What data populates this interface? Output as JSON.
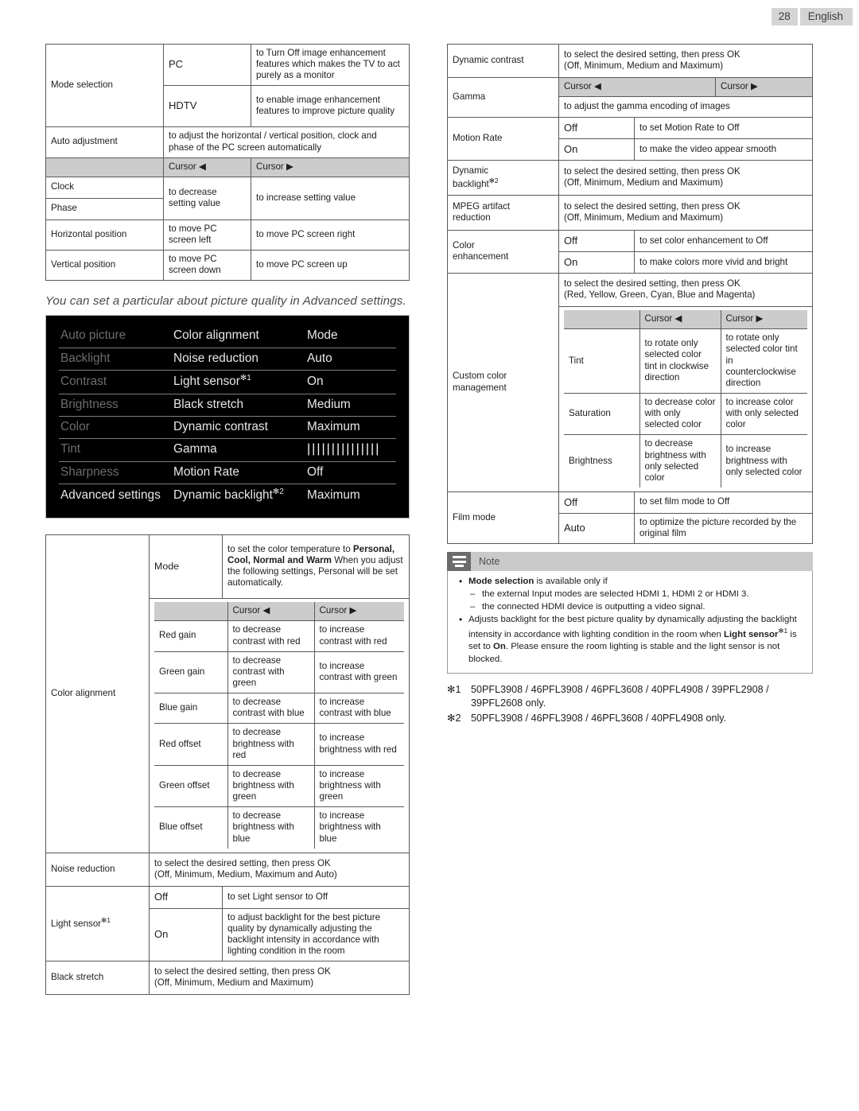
{
  "header": {
    "page_number": "28",
    "language": "English"
  },
  "left": {
    "table_pc": {
      "rows": [
        {
          "key": "Mode selection",
          "sub": [
            {
              "label": "PC",
              "desc": "to Turn Off image enhancement features which makes the TV to act purely as a monitor"
            },
            {
              "label": "HDTV",
              "desc": "to enable image enhancement features to improve picture quality"
            }
          ]
        },
        {
          "key": "Auto adjustment",
          "desc": "to adjust the horizontal / vertical position, clock and phase of the PC screen automatically"
        }
      ],
      "cursor_left": "Cursor ◀",
      "cursor_right": "Cursor ▶",
      "clock": "Clock",
      "phase": "Phase",
      "decrease_setting": "to decrease setting value",
      "increase_setting": "to increase setting value",
      "hpos": "Horizontal position",
      "hpos_left": "to move PC screen left",
      "hpos_right": "to move PC screen right",
      "vpos": "Vertical position",
      "vpos_left": "to move PC screen down",
      "vpos_right": "to move PC screen up"
    },
    "caption": "You can set a particular about picture quality in Advanced settings.",
    "osd": {
      "col1": [
        "Auto picture",
        "Backlight",
        "Contrast",
        "Brightness",
        "Color",
        "Tint",
        "Sharpness",
        "Advanced settings"
      ],
      "col2": [
        "Color alignment",
        "Noise reduction",
        "Light sensor",
        "Black stretch",
        "Dynamic contrast",
        "Gamma",
        "Motion Rate",
        "Dynamic backlight"
      ],
      "col2_sup": [
        "",
        "",
        "✻1",
        "",
        "",
        "",
        "",
        "✻2"
      ],
      "col3": [
        "Mode",
        "Auto",
        "On",
        "Medium",
        "Maximum",
        "|||||||||||||||",
        "Off",
        "Maximum"
      ],
      "highlighted_index": 7
    },
    "table_color": {
      "group_label": "Color alignment",
      "mode_label": "Mode",
      "mode_desc_pre": "to set the color temperature to ",
      "mode_desc_opts": "Personal, Cool, Normal and Warm",
      "mode_desc_post": "When you adjust the following settings, Personal will be set automatically.",
      "cursor_left": "Cursor ◀",
      "cursor_right": "Cursor ▶",
      "gains": [
        {
          "label": "Red gain",
          "dec": "to decrease contrast with red",
          "inc": "to increase contrast with red"
        },
        {
          "label": "Green gain",
          "dec": "to decrease contrast with green",
          "inc": "to increase contrast with green"
        },
        {
          "label": "Blue gain",
          "dec": "to decrease contrast with blue",
          "inc": "to increase contrast with blue"
        },
        {
          "label": "Red offset",
          "dec": "to decrease brightness with red",
          "inc": "to increase brightness with red"
        },
        {
          "label": "Green offset",
          "dec": "to decrease brightness with green",
          "inc": "to increase brightness with green"
        },
        {
          "label": "Blue offset",
          "dec": "to decrease brightness with blue",
          "inc": "to increase brightness with blue"
        }
      ],
      "noise_reduction": {
        "label": "Noise reduction",
        "desc_l1": "to select the desired setting, then press OK",
        "desc_l2": "(Off, Minimum, Medium, Maximum and Auto)"
      },
      "light_sensor": {
        "label": "Light sensor",
        "sup": "✻1",
        "off": "Off",
        "off_desc": "to set Light sensor to Off",
        "on": "On",
        "on_desc": "to adjust backlight for the best picture quality by dynamically adjusting the backlight intensity in accordance with lighting condition in the room"
      },
      "black_stretch": {
        "label": "Black stretch",
        "desc_l1": "to select the desired setting, then press OK",
        "desc_l2": "(Off, Minimum, Medium and Maximum)"
      }
    }
  },
  "right": {
    "dynamic_contrast": {
      "label": "Dynamic contrast",
      "desc_l1": "to select the desired setting, then press OK",
      "desc_l2": "(Off, Minimum, Medium and Maximum)"
    },
    "gamma": {
      "label": "Gamma",
      "cursor_left": "Cursor ◀",
      "cursor_right": "Cursor ▶",
      "desc": "to adjust the gamma encoding of images"
    },
    "motion_rate": {
      "label": "Motion Rate",
      "off": "Off",
      "off_desc": "to set Motion Rate to Off",
      "on": "On",
      "on_desc": "to make the video appear smooth"
    },
    "dynamic_backlight": {
      "label_l1": "Dynamic",
      "label_l2": "backlight",
      "sup": "✻2",
      "desc_l1": "to select the desired setting, then press OK",
      "desc_l2": "(Off, Minimum, Medium and Maximum)"
    },
    "mpeg": {
      "label_l1": "MPEG artifact",
      "label_l2": "reduction",
      "desc_l1": "to select the desired setting, then press OK",
      "desc_l2": "(Off, Minimum, Medium and Maximum)"
    },
    "color_enhancement": {
      "label_l1": "Color",
      "label_l2": "enhancement",
      "off": "Off",
      "off_desc": "to set color enhancement to Off",
      "on": "On",
      "on_desc": "to make colors more vivid and bright"
    },
    "custom_color": {
      "label_l1": "Custom color",
      "label_l2": "management",
      "desc_l1": "to select the desired setting, then press OK",
      "desc_l2": "(Red, Yellow, Green, Cyan, Blue and Magenta)",
      "cursor_left": "Cursor ◀",
      "cursor_right": "Cursor ▶",
      "rows": [
        {
          "label": "Tint",
          "dec": "to rotate only selected color tint in clockwise direction",
          "inc": "to rotate only selected color tint in counterclockwise direction"
        },
        {
          "label": "Saturation",
          "dec": "to decrease color with only selected color",
          "inc": "to increase color with only selected color"
        },
        {
          "label": "Brightness",
          "dec": "to decrease brightness with only selected color",
          "inc": "to increase brightness with only selected color"
        }
      ]
    },
    "film_mode": {
      "label": "Film mode",
      "off": "Off",
      "off_desc": "to set film mode to Off",
      "auto": "Auto",
      "auto_desc": "to optimize the picture recorded by the original film"
    },
    "note": {
      "title": "Note",
      "b1_bold": "Mode selection",
      "b1_rest": " is available only if",
      "b1_sub1": "the external Input modes are selected HDMI 1, HDMI 2 or HDMI 3.",
      "b1_sub2": "the connected HDMI device is outputting a video signal.",
      "b2_p1": "Adjusts backlight for the best picture quality by dynamically adjusting the backlight intensity in accordance with lighting condition in the room when ",
      "b2_bold1": "Light sensor",
      "b2_sup": "✻1",
      "b2_p2": " is set to ",
      "b2_bold2": "On",
      "b2_p3": ". Please ensure the room lighting is stable and the light sensor is not blocked."
    },
    "footnotes": [
      {
        "mark": "✻1",
        "text": "50PFL3908 / 46PFL3908 / 46PFL3608 / 40PFL4908 / 39PFL2908 / 39PFL2608 only."
      },
      {
        "mark": "✻2",
        "text": "50PFL3908 / 46PFL3908 / 46PFL3608 / 40PFL4908 only."
      }
    ]
  }
}
